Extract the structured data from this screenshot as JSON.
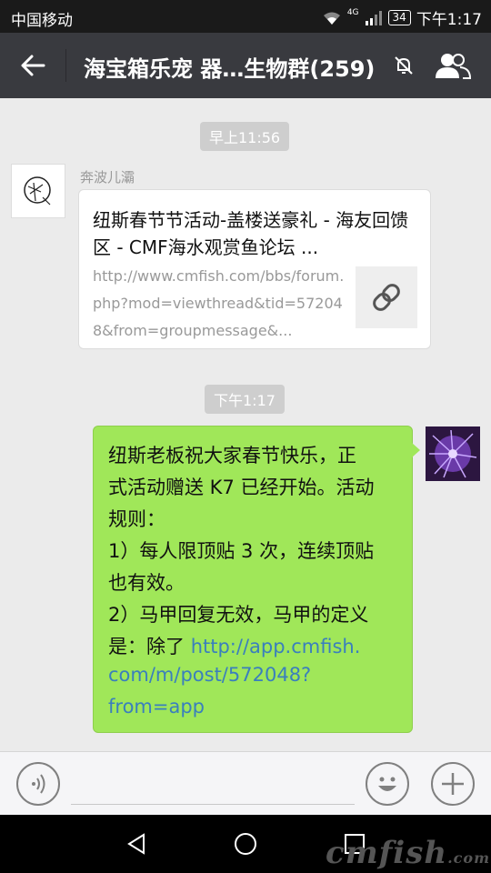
{
  "status_bar": {
    "carrier": "中国移动",
    "network": "4G",
    "battery": "34",
    "time": "下午1:17"
  },
  "nav": {
    "title": "海宝箱乐宠 器…生物群(259)",
    "icons": [
      "back-arrow-icon",
      "mute-bell-icon",
      "group-members-icon"
    ]
  },
  "messages": [
    {
      "type": "timestamp",
      "text": "早上11:56"
    },
    {
      "type": "link_card",
      "sender": "奔波儿灞",
      "title": "纽斯春节节活动-盖楼送豪礼 - 海友回馈区 - CMF海水观赏鱼论坛 ...",
      "url": "http://www.cmfish.com/bbs/forum.php?mod=viewthread&tid=572048&from=groupmessage&..."
    },
    {
      "type": "timestamp",
      "text": "下午1:17"
    },
    {
      "type": "text_self",
      "lines": [
        "纽斯老板祝大家春节快乐，正",
        "式活动赠送 K7 已经开始。活动",
        "规则：",
        "1）每人限顶贴 3 次，连续顶贴",
        "也有效。",
        "2）马甲回复无效，马甲的定义",
        "是：除了 "
      ],
      "link_lines": [
        "http://app.cmfish.",
        "com/m/post/572048?",
        "from=app"
      ]
    }
  ],
  "watermark": {
    "text": "cmfish",
    "suffix": ".com"
  },
  "colors": {
    "nav_bg": "#393a3f",
    "chat_bg": "#ebebeb",
    "bubble_green": "#a0e759",
    "link_blue": "#3a7fbd"
  }
}
